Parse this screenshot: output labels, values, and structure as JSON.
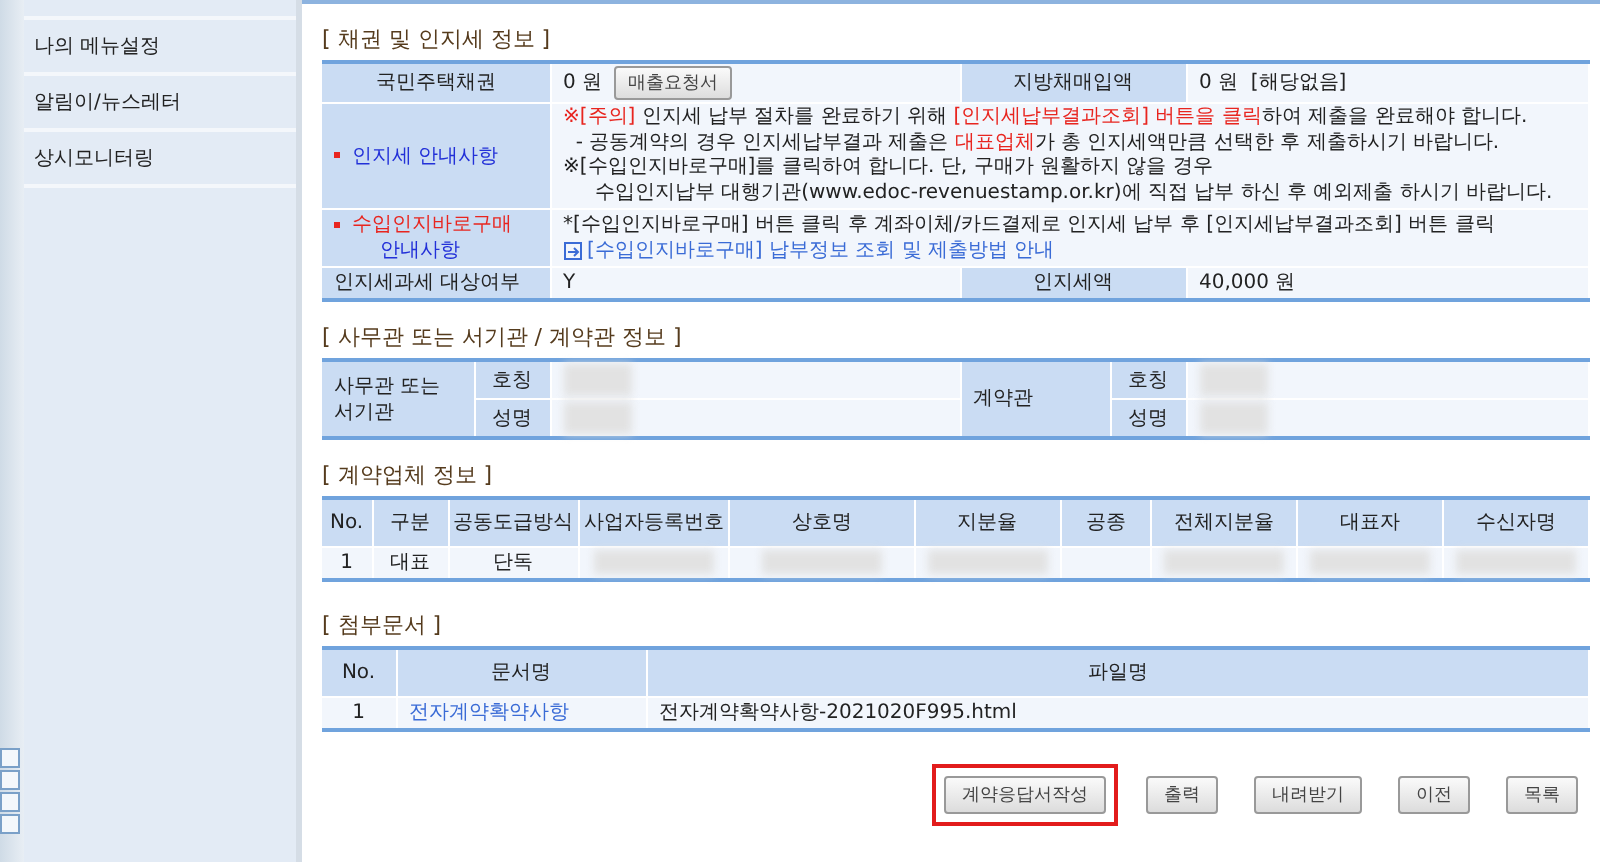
{
  "sidebar": {
    "items": [
      {
        "label": "나의 메뉴설정"
      },
      {
        "label": "알림이/뉴스레터"
      },
      {
        "label": "상시모니터링"
      }
    ]
  },
  "bond_section": {
    "title": "[ 채권 및 인지세 정보 ]",
    "housing_bond": {
      "label": "국민주택채권",
      "value": "0 원",
      "button": "매출요청서"
    },
    "local_bond": {
      "label": "지방채매입액",
      "value": "0 원  [해당없음]"
    },
    "stamp_notice": {
      "label": "인지세 안내사항",
      "lines": [
        [
          {
            "text": "※[주의]",
            "alert": true
          },
          {
            "text": " 인지세 납부 절차를 완료하기 위해 ",
            "alert": false
          },
          {
            "text": "[인지세납부결과조회] 버튼을 클릭",
            "alert": true
          },
          {
            "text": "하여 제출을 완료해야 합니다.",
            "alert": false
          }
        ],
        [
          {
            "text": "  - 공동계약의 경우 인지세납부결과 제출은 ",
            "alert": false
          },
          {
            "text": "대표업체",
            "alert": true
          },
          {
            "text": "가 총 인지세액만큼 선택한 후 제출하시기 바랍니다.",
            "alert": false
          }
        ],
        [
          {
            "text": "※[수입인지바로구매]를 클릭하여 합니다. 단, 구매가 원활하지 않을 경우",
            "alert": false
          }
        ],
        [
          {
            "text": "     수입인지납부 대행기관(www.edoc-revenuestamp.or.kr)에 직접 납부 하신 후 예외제출 하시기 바랍니다.",
            "alert": false
          }
        ]
      ]
    },
    "purchase_notice": {
      "label_lines": [
        {
          "text": "수입인지바로구매",
          "alert": true
        },
        {
          "text": "안내사항",
          "alert": false
        }
      ],
      "text": "*[수입인지바로구매] 버튼 클릭 후 계좌이체/카드결제로 인지세 납부 후 [인지세납부결과조회] 버튼 클릭",
      "link": "[수입인지바로구매] 납부정보 조회 및 제출방법 안내"
    },
    "taxable": {
      "label": "인지세과세 대상여부",
      "value": "Y"
    },
    "stamp_amount": {
      "label": "인지세액",
      "value": "40,000 원"
    }
  },
  "officer_section": {
    "title": "[ 사무관 또는 서기관 / 계약관 정보 ]",
    "groups": [
      {
        "label": "사무관 또는 서기관",
        "fields": [
          {
            "label": "호칭",
            "redacted": true
          },
          {
            "label": "성명",
            "redacted": true
          }
        ]
      },
      {
        "label": "계약관",
        "fields": [
          {
            "label": "호칭",
            "redacted": true
          },
          {
            "label": "성명",
            "redacted": true
          }
        ]
      }
    ]
  },
  "company_section": {
    "title": "[ 계약업체 정보 ]",
    "columns": [
      "No.",
      "구분",
      "공동도급방식",
      "사업자등록번호",
      "상호명",
      "지분율",
      "공종",
      "전체지분율",
      "대표자",
      "수신자명"
    ],
    "rows": [
      [
        {
          "text": "1",
          "redacted": false
        },
        {
          "text": "대표",
          "redacted": false
        },
        {
          "text": "단독",
          "redacted": false
        },
        {
          "redacted": true
        },
        {
          "redacted": true
        },
        {
          "redacted": true
        },
        {
          "redacted": false
        },
        {
          "redacted": true
        },
        {
          "redacted": true
        },
        {
          "redacted": true
        }
      ]
    ]
  },
  "attachment_section": {
    "title": "[ 첨부문서 ]",
    "columns": [
      "No.",
      "문서명",
      "파일명"
    ],
    "rows": [
      {
        "no": "1",
        "document": "전자계약확약사항",
        "file": "전자계약확약사항-2021020F995.html"
      }
    ]
  },
  "buttons": [
    {
      "label": "계약응답서작성",
      "highlighted": true
    },
    {
      "label": "출력",
      "highlighted": false
    },
    {
      "label": "내려받기",
      "highlighted": false
    },
    {
      "label": "이전",
      "highlighted": false
    },
    {
      "label": "목록",
      "highlighted": false
    }
  ]
}
